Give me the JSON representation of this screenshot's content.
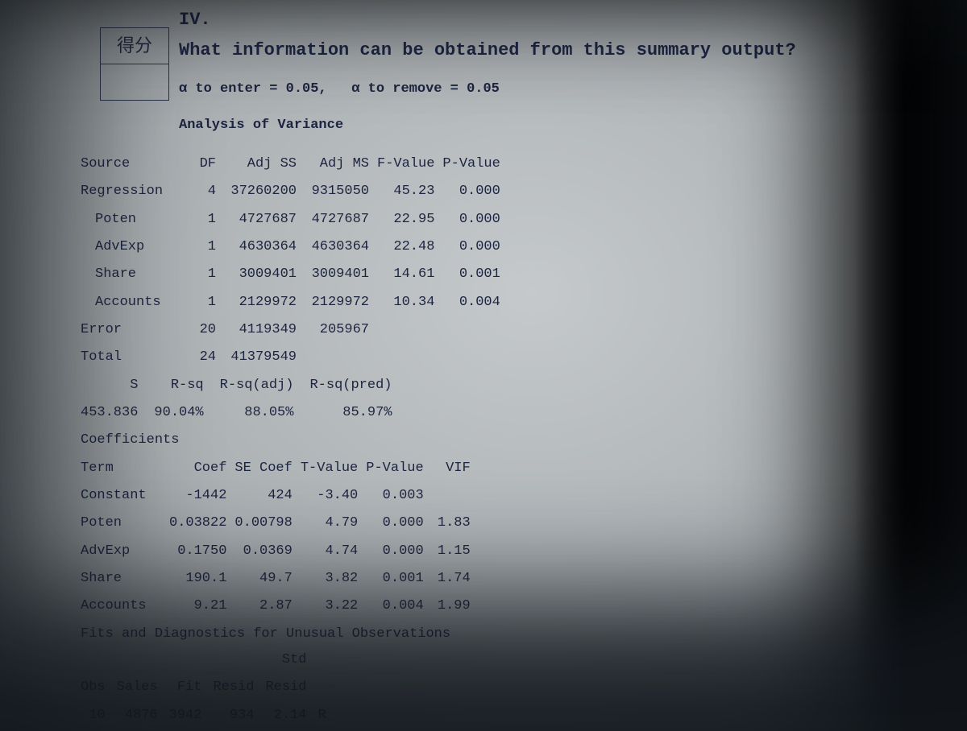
{
  "score_label": "得分",
  "section_number": "IV.",
  "question": "What information can be obtained from this summary output?",
  "alpha_line_a1": "α to enter = 0.05,",
  "alpha_line_a2": "α to remove = 0.05",
  "anova_title": "Analysis of Variance",
  "anova": {
    "head": {
      "src": "Source",
      "df": "DF",
      "adjss": "Adj SS",
      "adjms": "Adj MS",
      "f": "F-Value",
      "p": "P-Value"
    },
    "rows": [
      {
        "src": "Regression",
        "df": "4",
        "adjss": "37260200",
        "adjms": "9315050",
        "f": "45.23",
        "p": "0.000"
      },
      {
        "src": "Poten",
        "df": "1",
        "adjss": "4727687",
        "adjms": "4727687",
        "f": "22.95",
        "p": "0.000",
        "indent": true
      },
      {
        "src": "AdvExp",
        "df": "1",
        "adjss": "4630364",
        "adjms": "4630364",
        "f": "22.48",
        "p": "0.000",
        "indent": true
      },
      {
        "src": "Share",
        "df": "1",
        "adjss": "3009401",
        "adjms": "3009401",
        "f": "14.61",
        "p": "0.001",
        "indent": true
      },
      {
        "src": "Accounts",
        "df": "1",
        "adjss": "2129972",
        "adjms": "2129972",
        "f": "10.34",
        "p": "0.004",
        "indent": true
      },
      {
        "src": "Error",
        "df": "20",
        "adjss": "4119349",
        "adjms": "205967",
        "f": "",
        "p": ""
      },
      {
        "src": "Total",
        "df": "24",
        "adjss": "41379549",
        "adjms": "",
        "f": "",
        "p": ""
      }
    ]
  },
  "summary": {
    "head": {
      "s": "S",
      "rsq": "R-sq",
      "rsqa": "R-sq(adj)",
      "rsqp": "R-sq(pred)"
    },
    "vals": {
      "s": "453.836",
      "rsq": "90.04%",
      "rsqa": "88.05%",
      "rsqp": "85.97%"
    }
  },
  "coef_title": "Coefficients",
  "coef": {
    "head": {
      "term": "Term",
      "coef": "Coef",
      "se": "SE Coef",
      "t": "T-Value",
      "p": "P-Value",
      "vif": "VIF"
    },
    "rows": [
      {
        "term": "Constant",
        "coef": "-1442",
        "se": "424",
        "t": "-3.40",
        "p": "0.003",
        "vif": ""
      },
      {
        "term": "Poten",
        "coef": "0.03822",
        "se": "0.00798",
        "t": "4.79",
        "p": "0.000",
        "vif": "1.83"
      },
      {
        "term": "AdvExp",
        "coef": "0.1750",
        "se": "0.0369",
        "t": "4.74",
        "p": "0.000",
        "vif": "1.15"
      },
      {
        "term": "Share",
        "coef": "190.1",
        "se": "49.7",
        "t": "3.82",
        "p": "0.001",
        "vif": "1.74"
      },
      {
        "term": "Accounts",
        "coef": "9.21",
        "se": "2.87",
        "t": "3.22",
        "p": "0.004",
        "vif": "1.99"
      }
    ]
  },
  "fits_title": "Fits and Diagnostics for Unusual Observations",
  "obs": {
    "head": {
      "obs": "Obs",
      "sales": "Sales",
      "fit": "Fit",
      "resid": "Resid",
      "stdresid_a": "Std",
      "stdresid_b": "Resid",
      "flag": ""
    },
    "rows": [
      {
        "obs": "10",
        "sales": "4876",
        "fit": "3942",
        "resid": "934",
        "stdresid": "2.14",
        "flag": "R"
      }
    ]
  }
}
